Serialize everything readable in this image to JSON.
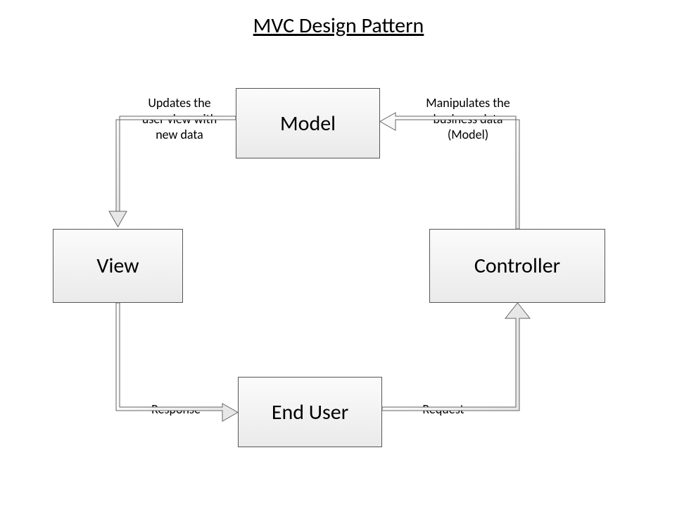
{
  "title": "MVC Design Pattern",
  "boxes": {
    "model": "Model",
    "view": "View",
    "controller": "Controller",
    "enduser": "End User"
  },
  "labels": {
    "updates": "Updates the\nuser view with\nnew data",
    "manipulates": "Manipulates the\nbusiness data\n(Model)",
    "response": "Response",
    "request": "Request"
  }
}
